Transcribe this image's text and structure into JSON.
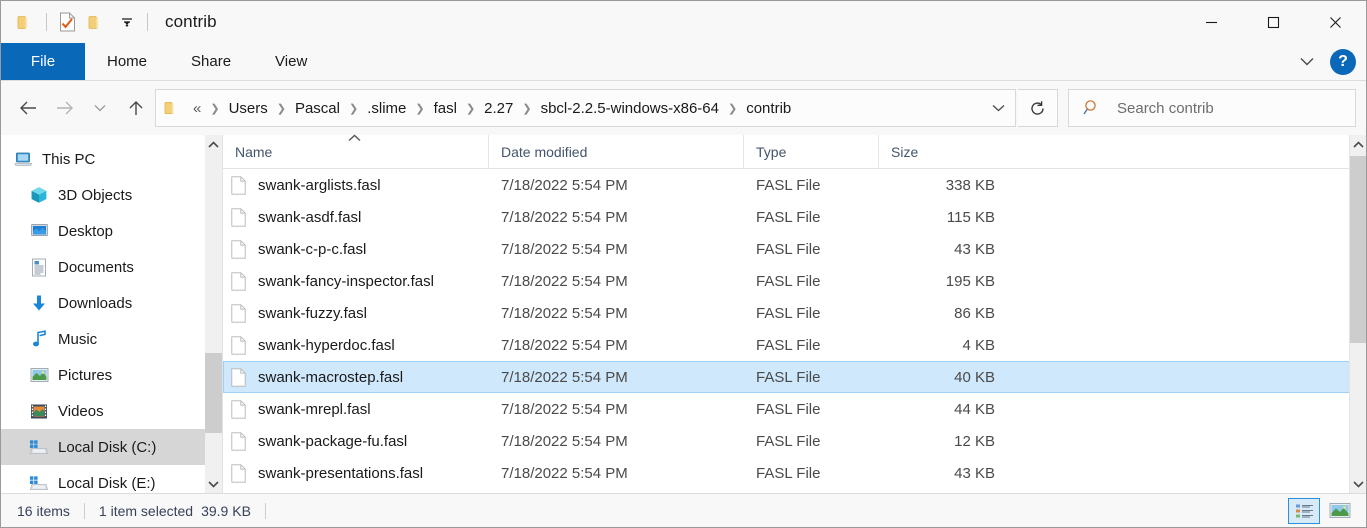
{
  "window": {
    "title": "contrib",
    "quick_access": [
      {
        "name": "folder-icon",
        "label": "Folder"
      },
      {
        "name": "properties-icon",
        "label": "Properties"
      },
      {
        "name": "new-folder-icon",
        "label": "New folder"
      },
      {
        "name": "chevron-down-icon",
        "label": "Customize Quick Access Toolbar"
      }
    ],
    "controls": {
      "minimize": "—",
      "maximize": "□",
      "close": "✕"
    }
  },
  "ribbon": {
    "tabs": [
      {
        "label": "File",
        "active": true
      },
      {
        "label": "Home",
        "active": false
      },
      {
        "label": "Share",
        "active": false
      },
      {
        "label": "View",
        "active": false
      }
    ],
    "expand_icon": "chevron-down-icon",
    "help_label": "?"
  },
  "address": {
    "back_icon": "arrow-left-icon",
    "forward_icon": "arrow-right-icon",
    "recent_icon": "chevron-down-icon",
    "up_icon": "arrow-up-icon",
    "ellipsis": "«",
    "crumbs": [
      "Users",
      "Pascal",
      ".slime",
      "fasl",
      "2.27",
      "sbcl-2.2.5-windows-x86-64",
      "contrib"
    ],
    "separator": "❯",
    "dropdown_icon": "chevron-down-icon",
    "refresh_icon": "refresh-icon"
  },
  "search": {
    "placeholder": "Search contrib",
    "icon": "search-icon"
  },
  "sidebar": {
    "items": [
      {
        "label": "This PC",
        "icon": "computer-icon",
        "indent": "root",
        "selected": false
      },
      {
        "label": "3D Objects",
        "icon": "cube-icon",
        "indent": "child",
        "selected": false
      },
      {
        "label": "Desktop",
        "icon": "desktop-icon",
        "indent": "child",
        "selected": false
      },
      {
        "label": "Documents",
        "icon": "documents-icon",
        "indent": "child",
        "selected": false
      },
      {
        "label": "Downloads",
        "icon": "download-icon",
        "indent": "child",
        "selected": false
      },
      {
        "label": "Music",
        "icon": "music-icon",
        "indent": "child",
        "selected": false
      },
      {
        "label": "Pictures",
        "icon": "pictures-icon",
        "indent": "child",
        "selected": false
      },
      {
        "label": "Videos",
        "icon": "videos-icon",
        "indent": "child",
        "selected": false
      },
      {
        "label": "Local Disk (C:)",
        "icon": "disk-icon",
        "indent": "child",
        "selected": true
      },
      {
        "label": "Local Disk (E:)",
        "icon": "disk-icon",
        "indent": "child",
        "selected": false
      }
    ]
  },
  "file_list": {
    "columns": [
      {
        "label": "Name",
        "key": "name"
      },
      {
        "label": "Date modified",
        "key": "date"
      },
      {
        "label": "Type",
        "key": "type"
      },
      {
        "label": "Size",
        "key": "size"
      }
    ],
    "sort": {
      "column": "Name",
      "direction": "ascending",
      "icon": "chevron-up-icon"
    },
    "rows": [
      {
        "name": "swank-arglists.fasl",
        "date": "7/18/2022 5:54 PM",
        "type": "FASL File",
        "size": "338 KB",
        "selected": false
      },
      {
        "name": "swank-asdf.fasl",
        "date": "7/18/2022 5:54 PM",
        "type": "FASL File",
        "size": "115 KB",
        "selected": false
      },
      {
        "name": "swank-c-p-c.fasl",
        "date": "7/18/2022 5:54 PM",
        "type": "FASL File",
        "size": "43 KB",
        "selected": false
      },
      {
        "name": "swank-fancy-inspector.fasl",
        "date": "7/18/2022 5:54 PM",
        "type": "FASL File",
        "size": "195 KB",
        "selected": false
      },
      {
        "name": "swank-fuzzy.fasl",
        "date": "7/18/2022 5:54 PM",
        "type": "FASL File",
        "size": "86 KB",
        "selected": false
      },
      {
        "name": "swank-hyperdoc.fasl",
        "date": "7/18/2022 5:54 PM",
        "type": "FASL File",
        "size": "4 KB",
        "selected": false
      },
      {
        "name": "swank-macrostep.fasl",
        "date": "7/18/2022 5:54 PM",
        "type": "FASL File",
        "size": "40 KB",
        "selected": true
      },
      {
        "name": "swank-mrepl.fasl",
        "date": "7/18/2022 5:54 PM",
        "type": "FASL File",
        "size": "44 KB",
        "selected": false
      },
      {
        "name": "swank-package-fu.fasl",
        "date": "7/18/2022 5:54 PM",
        "type": "FASL File",
        "size": "12 KB",
        "selected": false
      },
      {
        "name": "swank-presentations.fasl",
        "date": "7/18/2022 5:54 PM",
        "type": "FASL File",
        "size": "43 KB",
        "selected": false
      }
    ]
  },
  "status": {
    "item_count": "16 items",
    "selection": "1 item selected",
    "selection_size": "39.9 KB",
    "views": [
      {
        "name": "details-view",
        "label": "Details view",
        "active": true
      },
      {
        "name": "large-icons-view",
        "label": "Large icons view",
        "active": false
      }
    ]
  },
  "colors": {
    "accent": "#0a68b8",
    "selection": "#cfe8fc",
    "selection_border": "#9fd0f5",
    "nav_selected": "#d6d6d6",
    "folder_yellow": "#f5d27a"
  }
}
